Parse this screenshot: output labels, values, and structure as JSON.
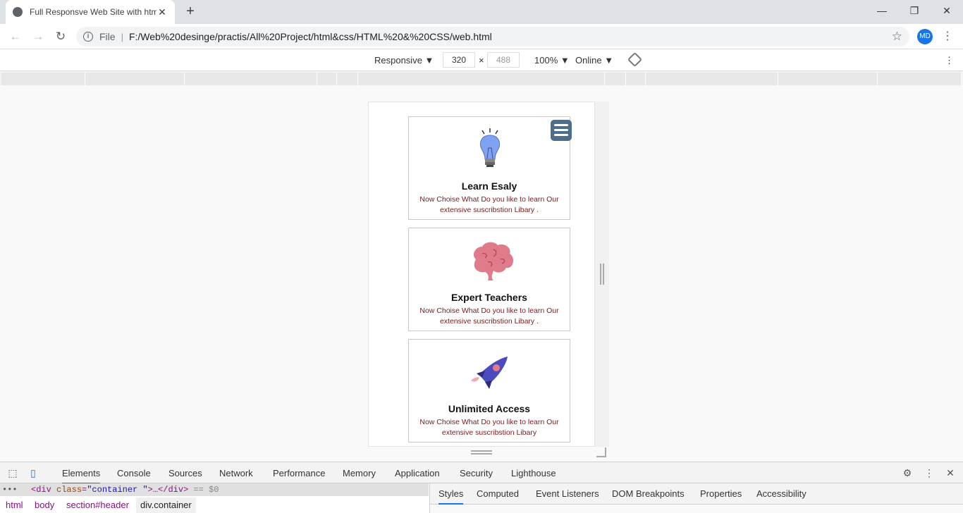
{
  "browser": {
    "tab_title": "Full Responsve Web Site with htm",
    "close_tab": "✕",
    "new_tab": "+",
    "window": {
      "minimize": "—",
      "maximize": "❐",
      "close": "✕"
    },
    "back": "←",
    "forward": "→",
    "reload": "↻",
    "info": "i",
    "file_label": "File",
    "separator": "|",
    "url": "F:/Web%20desinge/practis/All%20Project/html&css/HTML%20&%20CSS/web.html",
    "star": "☆",
    "avatar": "MD",
    "menu": "⋮"
  },
  "device_toolbar": {
    "mode": "Responsive ▼",
    "width": "320",
    "times": "×",
    "height": "488",
    "zoom": "100% ▼",
    "network": "Online ▼",
    "more": "⋮"
  },
  "page": {
    "cards": [
      {
        "title": "Learn Esaly",
        "text": "Now Choise What Do you like to learn Our extensive suscribstion Libary .",
        "icon": "lightbulb-icon"
      },
      {
        "title": "Expert Teachers",
        "text": "Now Choise What Do you like to learn Our extensive suscribstion Libary .",
        "icon": "brain-icon"
      },
      {
        "title": "Unlimited Access",
        "text": "Now Choise What Do you like to learn Our extensive suscribstion Libary",
        "icon": "rocket-icon"
      }
    ],
    "menu_icon": "hamburger-menu-icon"
  },
  "devtools": {
    "tabs": [
      "Elements",
      "Console",
      "Sources",
      "Network",
      "Performance",
      "Memory",
      "Application",
      "Security",
      "Lighthouse"
    ],
    "active_tab": "Elements",
    "selected": {
      "tag_open": "<div",
      "attr": "class",
      "eq": "=",
      "val": "\"container \"",
      "rest": ">…</div>",
      "note": "== $0",
      "more": "•••"
    },
    "breadcrumbs": [
      "html",
      "body",
      "section#header",
      "div.container"
    ],
    "side_tabs": [
      "Styles",
      "Computed",
      "Event Listeners",
      "DOM Breakpoints",
      "Properties",
      "Accessibility"
    ],
    "active_side_tab": "Styles",
    "settings": "⚙",
    "kebab": "⋮",
    "close": "✕"
  },
  "colors": {
    "accent": "#1a73e8",
    "menu_button": "#4e6f8c",
    "card_text": "#7a1a1a"
  }
}
